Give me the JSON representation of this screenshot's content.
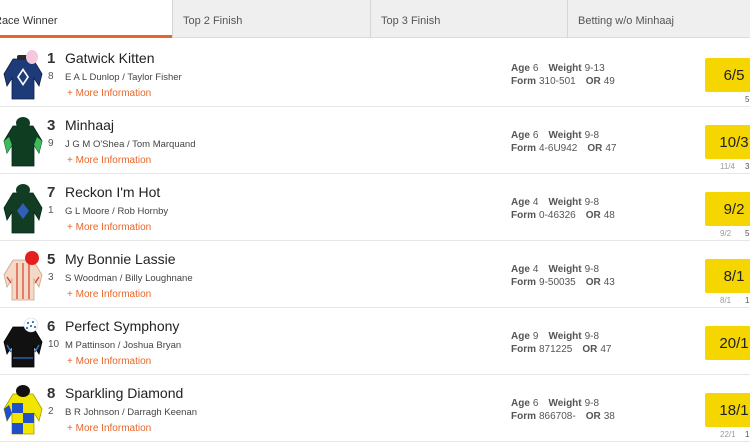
{
  "tabs": [
    {
      "label": "Race Winner",
      "active": true
    },
    {
      "label": "Top 2 Finish",
      "active": false
    },
    {
      "label": "Top 3 Finish",
      "active": false
    },
    {
      "label": "Betting w/o Minhaaj",
      "active": false
    }
  ],
  "labels": {
    "more_info": "+ More Information",
    "age": "Age",
    "weight": "Weight",
    "form": "Form",
    "or": "OR"
  },
  "colors": {
    "accent": "#e8662a",
    "odds_bg": "#f5d600"
  },
  "runners": [
    {
      "number": "1",
      "draw": "8",
      "name": "Gatwick Kitten",
      "connections": "E A L Dunlop / Taylor Fisher",
      "age": "6",
      "weight": "9-13",
      "form": "310-501",
      "or": "49",
      "odds": "6/5",
      "prev": "",
      "prev2": "5",
      "silk": "navy-white-diamond-pink-cap"
    },
    {
      "number": "3",
      "draw": "9",
      "name": "Minhaaj",
      "connections": "J G M O'Shea / Tom Marquand",
      "age": "6",
      "weight": "9-8",
      "form": "4-6U942",
      "or": "47",
      "odds": "10/3",
      "prev": "11/4",
      "prev2": "3",
      "silk": "dark-green-light-green-sleeves"
    },
    {
      "number": "7",
      "draw": "1",
      "name": "Reckon I'm Hot",
      "connections": "G L Moore / Rob Hornby",
      "age": "4",
      "weight": "9-8",
      "form": "0-46326",
      "or": "48",
      "odds": "9/2",
      "prev": "9/2",
      "prev2": "5",
      "silk": "dark-green-blue-diamond"
    },
    {
      "number": "5",
      "draw": "3",
      "name": "My Bonnie Lassie",
      "connections": "S Woodman / Billy Loughnane",
      "age": "4",
      "weight": "9-8",
      "form": "9-50035",
      "or": "43",
      "odds": "8/1",
      "prev": "8/1",
      "prev2": "1",
      "silk": "peach-red-stripes-red-cap"
    },
    {
      "number": "6",
      "draw": "10",
      "name": "Perfect Symphony",
      "connections": "M Pattinson / Joshua Bryan",
      "age": "9",
      "weight": "9-8",
      "form": "871225",
      "or": "47",
      "odds": "20/1",
      "prev": "",
      "prev2": "",
      "silk": "black-blue-stripes-spotted-cap"
    },
    {
      "number": "8",
      "draw": "2",
      "name": "Sparkling Diamond",
      "connections": "B R Johnson / Darragh Keenan",
      "age": "6",
      "weight": "9-8",
      "form": "866708-",
      "or": "38",
      "odds": "18/1",
      "prev": "22/1",
      "prev2": "1",
      "silk": "yellow-blue-check-black-cap"
    }
  ]
}
